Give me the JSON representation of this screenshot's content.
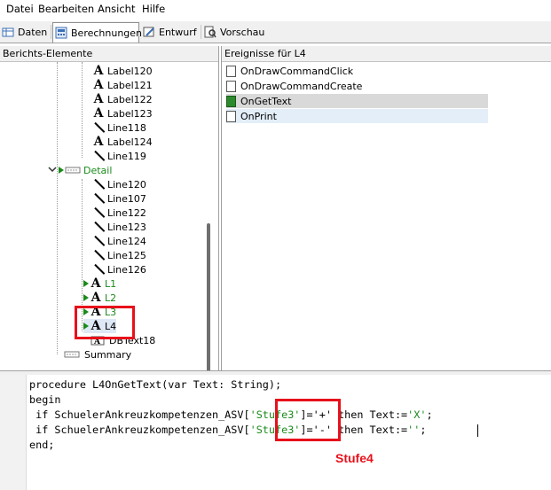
{
  "menu": [
    "Datei",
    "Bearbeiten",
    "Ansicht",
    "Hilfe"
  ],
  "tabs": [
    {
      "label": "Daten",
      "icon": "data-icon",
      "active": false
    },
    {
      "label": "Berechnungen",
      "icon": "calc-icon",
      "active": true
    },
    {
      "label": "Entwurf",
      "icon": "design-icon",
      "active": false
    },
    {
      "label": "Vorschau",
      "icon": "preview-icon",
      "active": false
    }
  ],
  "left_panel": {
    "title": "Berichts-Elemente",
    "items": [
      {
        "label": "Label120",
        "icon": "label-icon"
      },
      {
        "label": "Label121",
        "icon": "label-icon"
      },
      {
        "label": "Label122",
        "icon": "label-icon"
      },
      {
        "label": "Label123",
        "icon": "label-icon"
      },
      {
        "label": "Line118",
        "icon": "line-icon"
      },
      {
        "label": "Label124",
        "icon": "label-icon"
      },
      {
        "label": "Line119",
        "icon": "line-icon"
      },
      {
        "label": "Detail",
        "icon": "band-icon"
      },
      {
        "label": "Line120",
        "icon": "line-icon"
      },
      {
        "label": "Line107",
        "icon": "line-icon"
      },
      {
        "label": "Line122",
        "icon": "line-icon"
      },
      {
        "label": "Line123",
        "icon": "line-icon"
      },
      {
        "label": "Line124",
        "icon": "line-icon"
      },
      {
        "label": "Line125",
        "icon": "line-icon"
      },
      {
        "label": "Line126",
        "icon": "line-icon"
      },
      {
        "label": "L1",
        "icon": "label-icon"
      },
      {
        "label": "L2",
        "icon": "label-icon"
      },
      {
        "label": "L3",
        "icon": "label-icon"
      },
      {
        "label": "L4",
        "icon": "label-icon"
      },
      {
        "label": "DBText18",
        "icon": "dbtext-icon"
      },
      {
        "label": "Summary",
        "icon": "band-icon"
      }
    ]
  },
  "right_panel": {
    "title": "Ereignisse für L4",
    "events": [
      {
        "label": "OnDrawCommandClick"
      },
      {
        "label": "OnDrawCommandCreate"
      },
      {
        "label": "OnGetText"
      },
      {
        "label": "OnPrint"
      }
    ]
  },
  "code": {
    "lines": {
      "l1": "procedure L4OnGetText(var Text: String);",
      "l2": "begin",
      "l3_pre": " if SchuelerAnkreuzkompetenzen_ASV[",
      "l3_str": "'Stufe3'",
      "l3_mid": "]='+' then Text:=",
      "l3_end": "'X'",
      "l3_semi": ";",
      "l4_pre": " if SchuelerAnkreuzkompetenzen_ASV[",
      "l4_str": "'Stufe3'",
      "l4_mid": "]='-' then Text:=",
      "l4_end": "''",
      "l4_semi": ";",
      "l5": "end;"
    }
  },
  "annotation": {
    "text": "Stufe4",
    "color": "#e8101a"
  },
  "colors": {
    "string": "#1a8a1a",
    "highlight_red": "#e8101a",
    "selected_row": "#d9d9d9"
  }
}
